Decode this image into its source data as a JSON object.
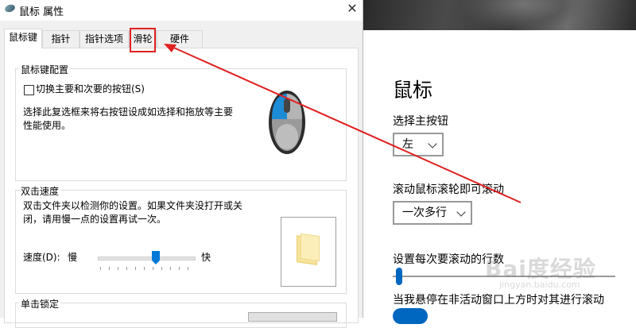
{
  "dialog": {
    "title": "鼠标 属性",
    "close_glyph": "✕",
    "tabs": [
      "鼠标键",
      "指针",
      "指针选项",
      "滑轮",
      "硬件"
    ],
    "active_tab": "鼠标键",
    "highlighted_tab": "滑轮",
    "button_config": {
      "title": "鼠标键配置",
      "checkbox_label": "切换主要和次要的按钮(S)",
      "checkbox_checked": false,
      "description_line1": "选择此复选框来将右按钮设成如选择和拖放等主要",
      "description_line2": "性能使用。"
    },
    "double_click": {
      "title": "双击速度",
      "description_line1": "双击文件夹以检测你的设置。如果文件夹没打开或关",
      "description_line2": "闭，请用慢一点的设置再试一次。",
      "speed_label": "速度(D):",
      "slow_label": "慢",
      "fast_label": "快",
      "speed_value_fraction": 0.6
    },
    "click_lock": {
      "title": "单击锁定"
    }
  },
  "settings": {
    "heading": "鼠标",
    "primary_button_label": "选择主按钮",
    "primary_button_value": "左",
    "scroll_label": "滚动鼠标滚轮即可滚动",
    "scroll_value": "一次多行",
    "lines_label": "设置每次要滚动的行数",
    "lines_value_fraction": 0.03,
    "inactive_scroll_label": "当我悬停在非活动窗口上方时对其进行滚动",
    "inactive_scroll_on": true
  },
  "watermark": {
    "text": "Bai度经验",
    "sub": "jingyan.baidu.com"
  },
  "colors": {
    "annotation": "#e02020",
    "accent": "#0078d7",
    "settings_accent": "#0067c0"
  }
}
